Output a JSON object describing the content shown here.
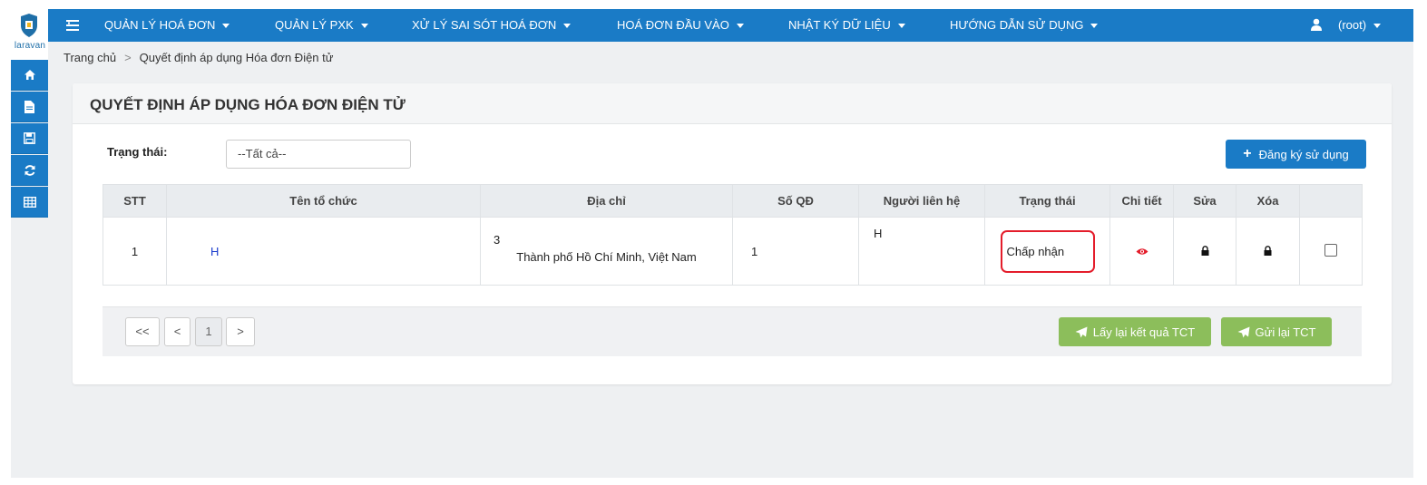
{
  "brand": {
    "word": "laravan"
  },
  "rail": {
    "icons": [
      "home-icon",
      "file-icon",
      "save-icon",
      "refresh-icon",
      "table-icon"
    ]
  },
  "nav": {
    "items": [
      {
        "label": "QUẢN LÝ HOÁ ĐƠN"
      },
      {
        "label": "QUẢN LÝ PXK"
      },
      {
        "label": "XỬ LÝ SAI SÓT HOÁ ĐƠN"
      },
      {
        "label": "HOÁ ĐƠN ĐẦU VÀO"
      },
      {
        "label": "NHẬT KÝ DỮ LIỆU"
      },
      {
        "label": "HƯỚNG DẪN SỬ DỤNG"
      }
    ],
    "user": "(root)"
  },
  "breadcrumb": {
    "home": "Trang chủ",
    "separator": ">",
    "current": "Quyết định áp dụng Hóa đơn Điện tử"
  },
  "page": {
    "title": "QUYẾT ĐỊNH ÁP DỤNG HÓA ĐƠN ĐIỆN TỬ",
    "filter_label": "Trạng thái:",
    "filter_value": "--Tất cả--",
    "register_button": "Đăng ký sử dụng"
  },
  "table": {
    "headers": [
      "STT",
      "Tên tổ chức",
      "Địa chỉ",
      "Số QĐ",
      "Người liên hệ",
      "Trạng thái",
      "Chi tiết",
      "Sửa",
      "Xóa",
      ""
    ],
    "rows": [
      {
        "stt": "1",
        "org": "H",
        "address_line1": "3",
        "address_line2": "Thành phố Hồ Chí Minh, Việt Nam",
        "decision_no": "1",
        "contact": "H",
        "status": "Chấp nhận"
      }
    ]
  },
  "pagination": {
    "first": "<<",
    "prev": "<",
    "page": "1",
    "next": ">"
  },
  "actions": {
    "fetch_result": "Lấy lại kết quả TCT",
    "resend": "Gửi lại TCT"
  },
  "colors": {
    "primary": "#1a7bc6",
    "success": "#8cbe5b",
    "highlight": "#e41d2b",
    "detail_icon": "#e41d2b"
  }
}
